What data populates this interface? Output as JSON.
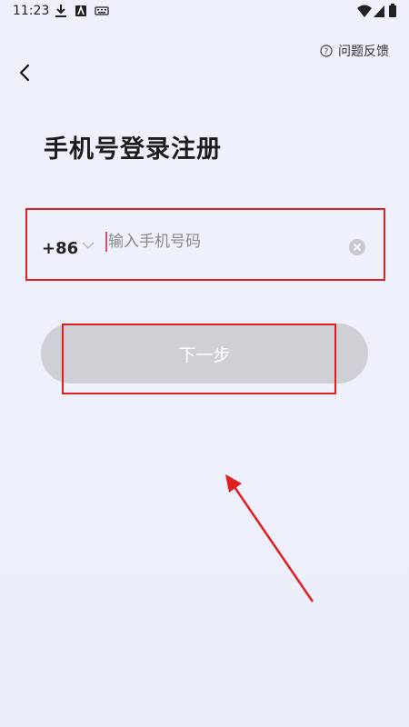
{
  "status": {
    "time": "11:23",
    "icons": [
      "download-icon",
      "app-icon",
      "keyboard-icon",
      "wifi-icon",
      "cellular-icon",
      "battery-icon"
    ]
  },
  "header": {
    "back_icon": "chevron-left-icon",
    "feedback_icon": "help-circle-icon",
    "feedback_label": "问题反馈"
  },
  "page": {
    "title": "手机号登录注册"
  },
  "phone": {
    "country_code": "+86",
    "placeholder": "输入手机号码",
    "value": ""
  },
  "next_button": {
    "label": "下一步"
  },
  "colors": {
    "annotation": "#e02020",
    "button_disabled": "#cfd0d5",
    "background": "#eef0fb"
  }
}
